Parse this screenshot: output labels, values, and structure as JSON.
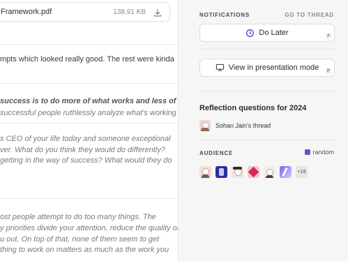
{
  "attachment": {
    "name": "Framework.pdf",
    "size": "138.91 KB"
  },
  "doc": {
    "line1": "mpts which looked really good. The rest were kinda",
    "q1_line1": "success is to do more of what works and less of",
    "q1_line2": "successful people ruthlessly analyze what's working",
    "q2_line1": "s CEO of your life today and someone exceptional",
    "q2_line2": "ver. What do you think they would do differently?",
    "q2_line3": "getting in the way of success? What would they do",
    "p3_line1": "ost people attempt to do too many things. The",
    "p3_line2": "y priorities divide your attention, reduce the quality of",
    "p3_line3": "u out. On top of that, none of them seem to get",
    "p3_line4": "thing to work on matters as much as the work you"
  },
  "panel": {
    "notifications_label": "NOTIFICATIONS",
    "go_to_thread": "GO TO THREAD",
    "do_later": "Do Later",
    "do_later_key": "F",
    "presentation": "View in presentation mode",
    "presentation_key": "P",
    "reflection_title": "Reflection questions for 2024",
    "thread_owner": "Sohan Jain's thread",
    "audience_label": "AUDIENCE",
    "channel": "random",
    "more_count": "+19"
  },
  "colors": {
    "panel_bg": "#f6f6f6",
    "accent": "#6a4fc7"
  }
}
